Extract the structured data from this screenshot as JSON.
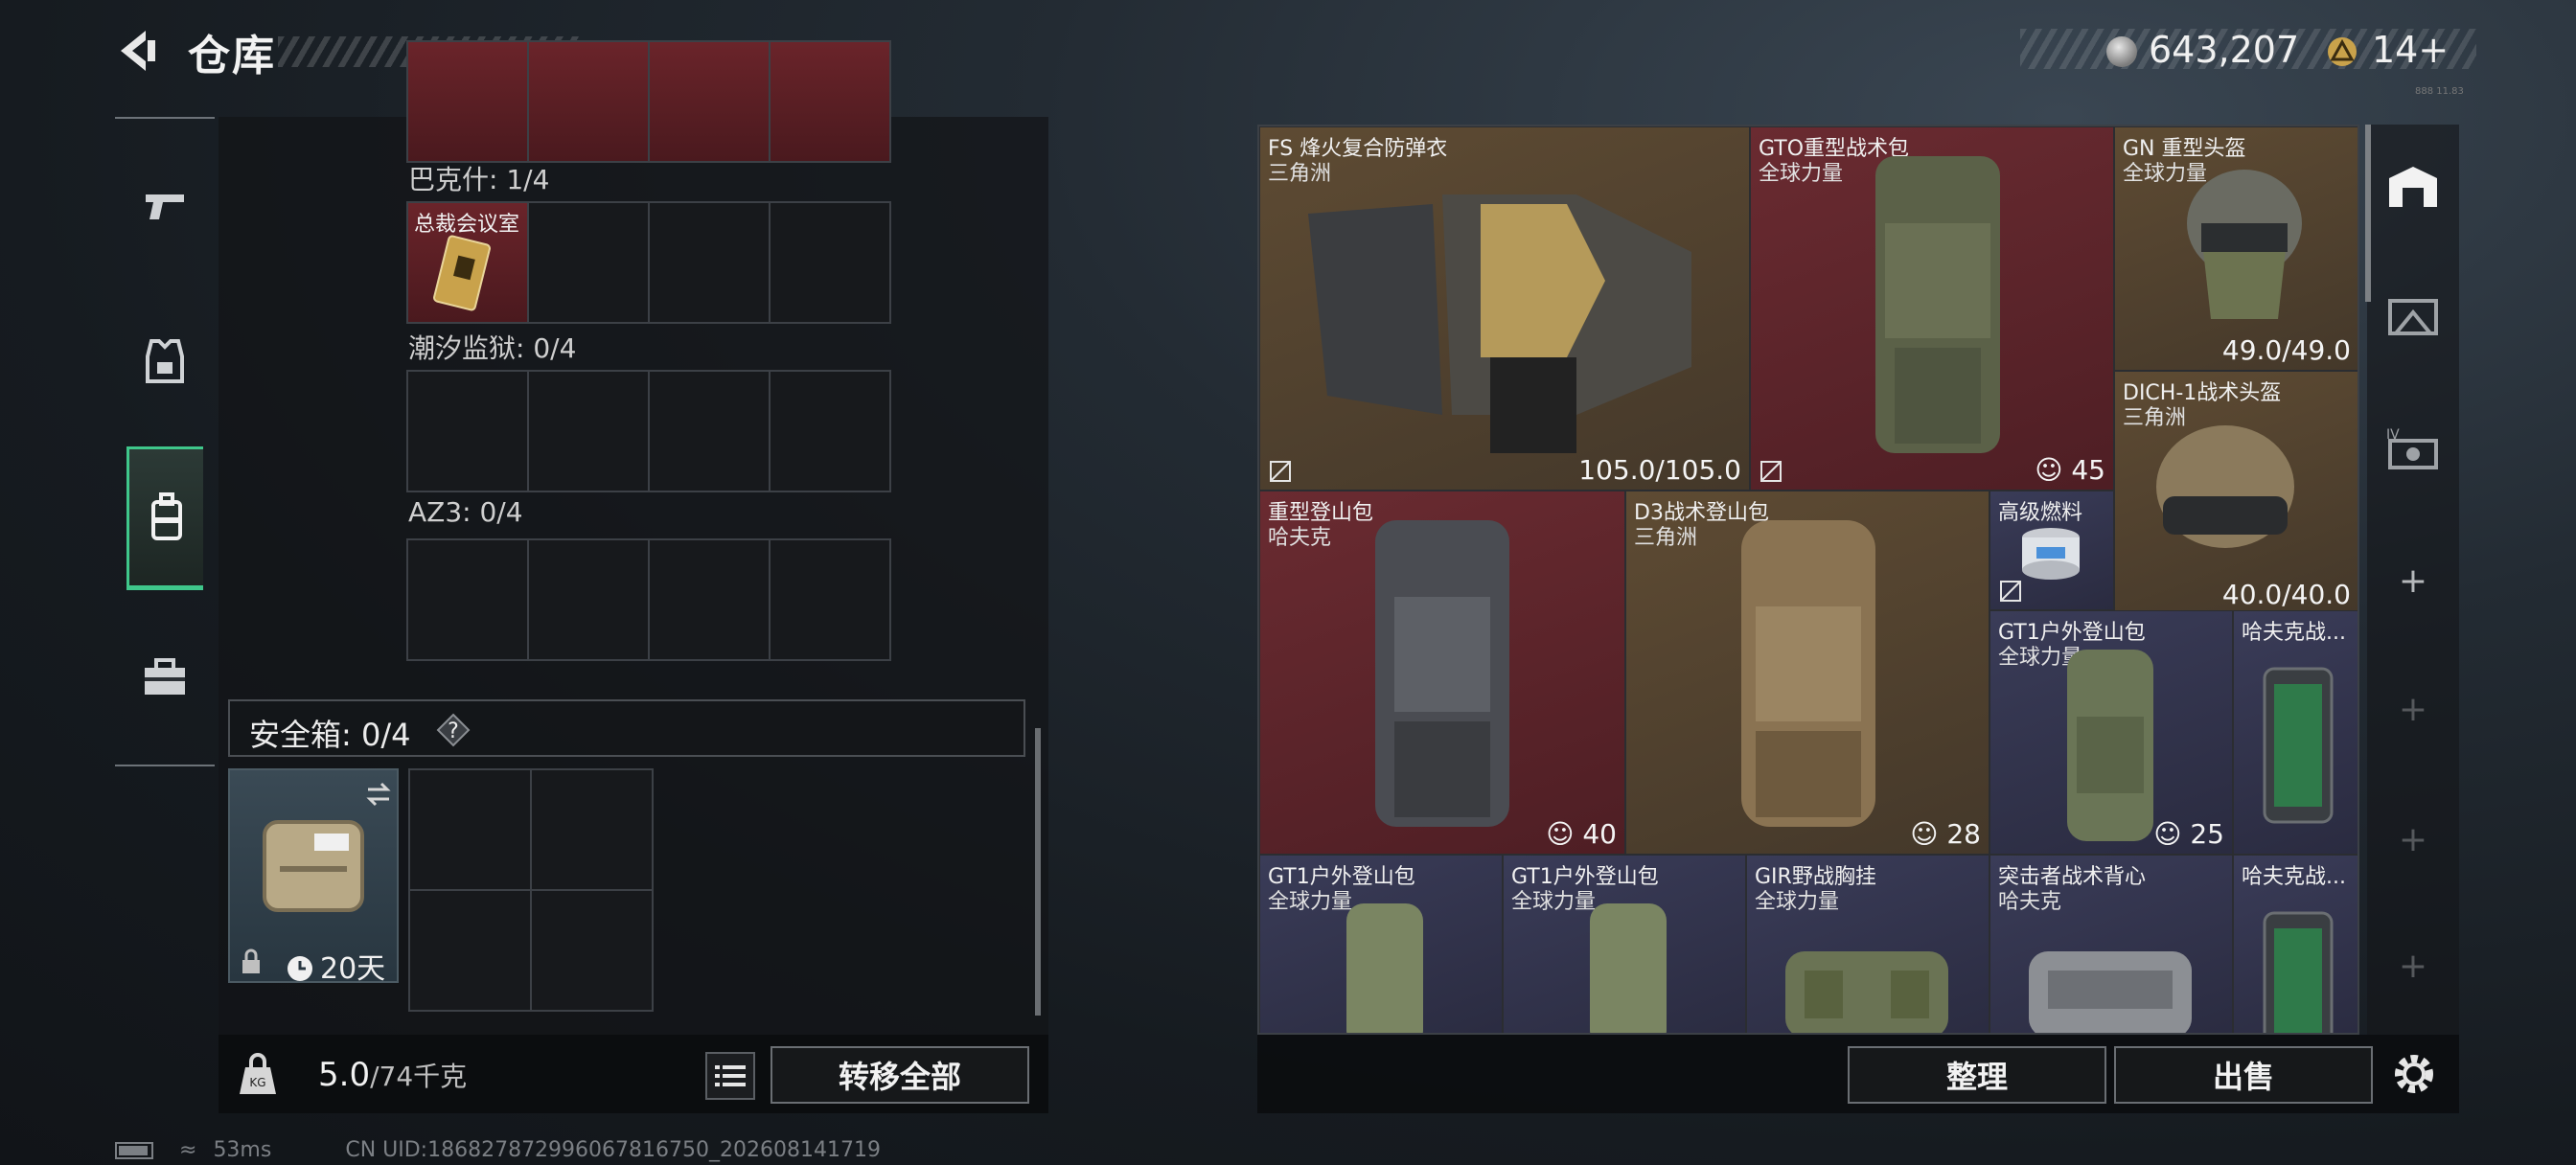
{
  "header": {
    "title": "仓库",
    "coins": "643,207",
    "tickets": "14",
    "tickets_plus": "+",
    "tiny_text": "888 11.83"
  },
  "left_nav": {
    "items": [
      "weapons-icon",
      "armor-icon",
      "backpack-icon",
      "toolbox-icon"
    ],
    "active_index": 2
  },
  "containers": [
    {
      "label": "巴克什: 1/4",
      "card": "总裁会议室"
    },
    {
      "label": "潮汐监狱: 0/4"
    },
    {
      "label": "AZ3: 0/4"
    }
  ],
  "safe_box": {
    "label": "安全箱: 0/4",
    "help": "?",
    "days": "20天"
  },
  "weight": {
    "current": "5.0",
    "capacity": "/74千克"
  },
  "buttons": {
    "transfer_all": "转移全部",
    "sort": "整理",
    "sell": "出售"
  },
  "items": [
    {
      "name": "FS 烽火复合防弹衣",
      "maker": "三角洲",
      "durability": "105.0/105.0",
      "color": "gold"
    },
    {
      "name": "GTO重型战术包",
      "maker": "全球力量",
      "count": "45",
      "color": "red"
    },
    {
      "name": "GN 重型头盔",
      "maker": "全球力量",
      "durability": "49.0/49.0",
      "color": "gold"
    },
    {
      "name": "DICH-1战术头盔",
      "maker": "三角洲",
      "durability": "40.0/40.0",
      "color": "gold"
    },
    {
      "name": "重型登山包",
      "maker": "哈夫克",
      "count": "40",
      "color": "red"
    },
    {
      "name": "D3战术登山包",
      "maker": "三角洲",
      "count": "28",
      "color": "gold"
    },
    {
      "name": "高级燃料",
      "color": "purple"
    },
    {
      "name": "GT1户外登山包",
      "maker": "全球力量",
      "count": "25",
      "color": "purple"
    },
    {
      "name": "哈夫克战...",
      "color": "purple"
    },
    {
      "name": "GT1户外登山包",
      "maker": "全球力量",
      "color": "purple"
    },
    {
      "name": "GT1户外登山包",
      "maker": "全球力量",
      "color": "purple"
    },
    {
      "name": "GIR野战胸挂",
      "maker": "全球力量",
      "color": "purple"
    },
    {
      "name": "突击者战术背心",
      "maker": "哈夫克",
      "color": "purple"
    },
    {
      "name": "哈夫克战...",
      "color": "purple"
    }
  ],
  "status": {
    "ping": "53ms",
    "uid": "CN UID:186827872996067816750_202608141719"
  },
  "colors": {
    "accent_green": "#3fc78b",
    "rarity_gold": "#5e4b33",
    "rarity_red": "#6a2b31",
    "rarity_purple": "#3a3c58"
  }
}
